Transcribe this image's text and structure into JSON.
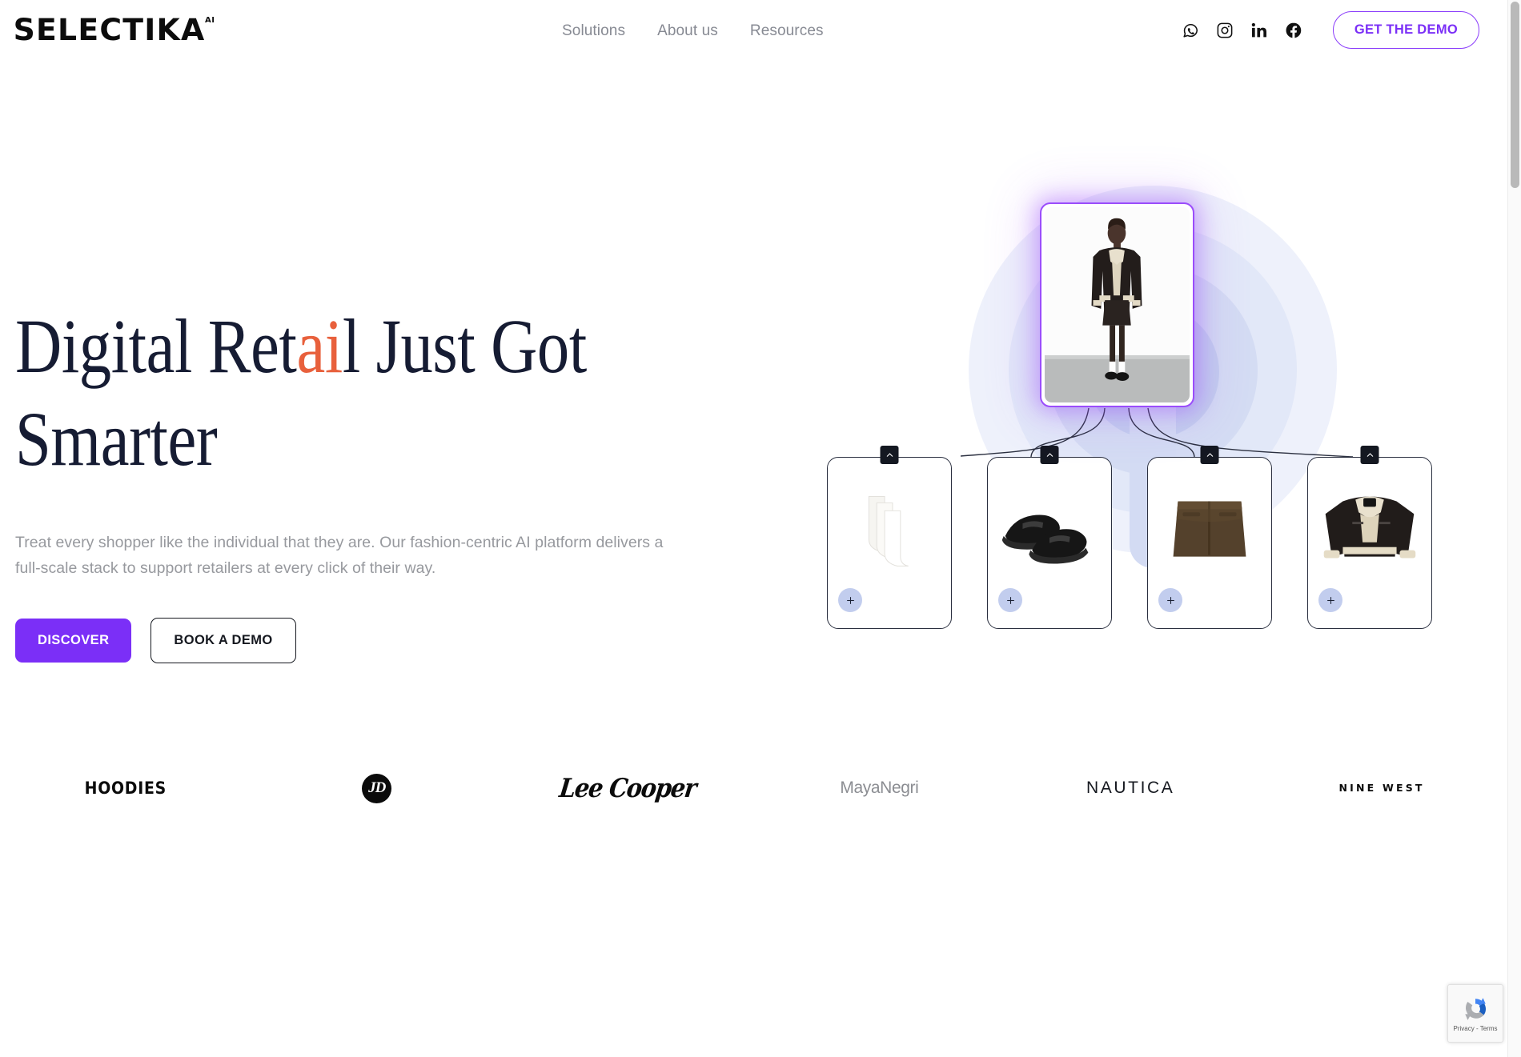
{
  "header": {
    "logo": {
      "wordmark": "SELECTIKA",
      "superscript": "AI"
    },
    "nav": [
      {
        "label": "Solutions",
        "name": "nav-solutions"
      },
      {
        "label": "About us",
        "name": "nav-about-us"
      },
      {
        "label": "Resources",
        "name": "nav-resources"
      }
    ],
    "social": [
      {
        "name": "whatsapp-icon",
        "label": "WhatsApp"
      },
      {
        "name": "instagram-icon",
        "label": "Instagram"
      },
      {
        "name": "linkedin-icon",
        "label": "LinkedIn"
      },
      {
        "name": "facebook-icon",
        "label": "Facebook"
      }
    ],
    "demo_button": "GET THE DEMO"
  },
  "hero": {
    "title_part1": "Digital Ret",
    "title_accent": "ai",
    "title_part2": "l Just Got",
    "title_line2": "Smarter",
    "subtitle": "Treat every shopper like the individual that they are. Our fashion-centric AI platform delivers a full-scale stack to support retailers at every click of their way.",
    "primary_cta": "DISCOVER",
    "secondary_cta": "BOOK A DEMO",
    "outfit_card_alt": "Model wearing black shearling jacket, brown leather mini skirt, white socks and black loafers",
    "products": [
      {
        "name": "product-card-socks",
        "alt": "White ribbed socks",
        "add_label": "+"
      },
      {
        "name": "product-card-loafers",
        "alt": "Black patent penny loafers",
        "add_label": "+"
      },
      {
        "name": "product-card-skirt",
        "alt": "Brown leather mini skirt",
        "add_label": "+"
      },
      {
        "name": "product-card-jacket",
        "alt": "Black shearling aviator jacket",
        "add_label": "+"
      }
    ]
  },
  "brands": [
    {
      "name": "brand-hoodies",
      "label": "HOODIES",
      "style": "hoodies"
    },
    {
      "name": "brand-jd",
      "label": "JD",
      "style": "jd"
    },
    {
      "name": "brand-lee-cooper",
      "label": "Lee Cooper",
      "style": "leecooper"
    },
    {
      "name": "brand-maya-negri",
      "label": "MayaNegri",
      "style": "maya"
    },
    {
      "name": "brand-nautica",
      "label": "NAUTICA",
      "style": "nautica"
    },
    {
      "name": "brand-nine-west",
      "label_top": "NINE",
      "label_bottom": "WEST",
      "style": "ninewest"
    }
  ],
  "recaptcha": {
    "text": "Privacy - Terms"
  },
  "colors": {
    "accent_purple": "#7b2ff7",
    "accent_orange": "#e8603c",
    "headline_navy": "#161c33",
    "body_gray": "#97999e",
    "halo_periwinkle": "#c3cdee",
    "add_button": "#c2cdee"
  }
}
